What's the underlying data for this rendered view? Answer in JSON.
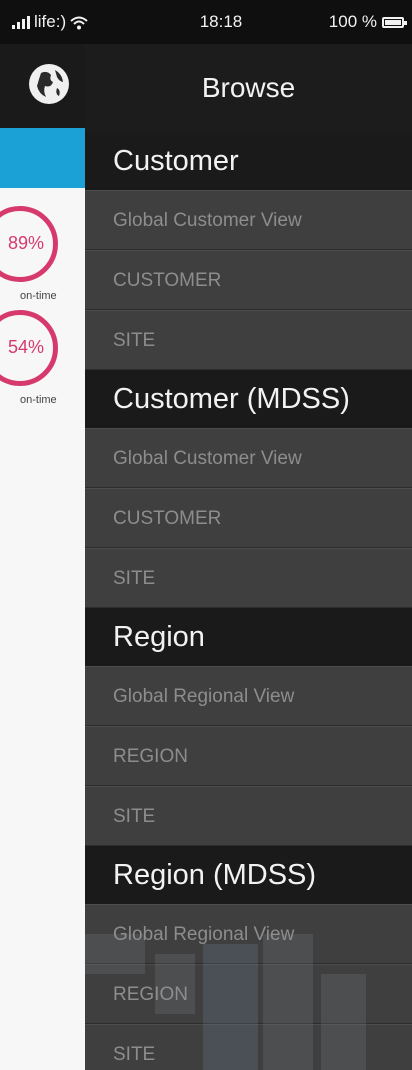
{
  "status_bar": {
    "carrier": "life:)",
    "time": "18:18",
    "battery": "100 %"
  },
  "left_panel": {
    "gauges": [
      {
        "value": "89%",
        "caption": "on-time"
      },
      {
        "value": "54%",
        "caption": "on-time"
      }
    ]
  },
  "drawer": {
    "title": "Browse",
    "sections": [
      {
        "header": "Customer",
        "items": [
          "Global Customer View",
          "CUSTOMER",
          "SITE"
        ]
      },
      {
        "header": "Customer (MDSS)",
        "items": [
          "Global Customer View",
          "CUSTOMER",
          "SITE"
        ]
      },
      {
        "header": "Region",
        "items": [
          "Global Regional View",
          "REGION",
          "SITE"
        ]
      },
      {
        "header": "Region (MDSS)",
        "items": [
          "Global Regional View",
          "REGION",
          "SITE"
        ]
      }
    ]
  },
  "colors": {
    "accent_blue": "#1ba1d6",
    "gauge_pink": "#d63a6c",
    "drawer_bg": "#3d3d3d",
    "header_bg": "#1a1a1a"
  },
  "icons": [
    "signal-bars-icon",
    "wifi-icon",
    "battery-icon",
    "globe-icon"
  ]
}
